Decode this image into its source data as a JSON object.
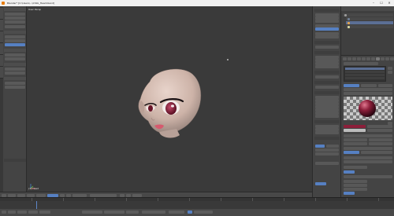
{
  "window": {
    "title": "Blender* [C:\\Users\\...\\Chibi_Head.blend]",
    "minimize_glyph": "–",
    "maximize_glyph": "☐",
    "close_glyph": "✕"
  },
  "viewport": {
    "view_label": "User Persp",
    "object_label": "(1) Head"
  },
  "colors": {
    "skin": "#cdb3a8",
    "iris": "#7a1832",
    "lips": "#d65a6e",
    "accent": "#5680c2",
    "material_sphere": "#8c1f3a"
  }
}
